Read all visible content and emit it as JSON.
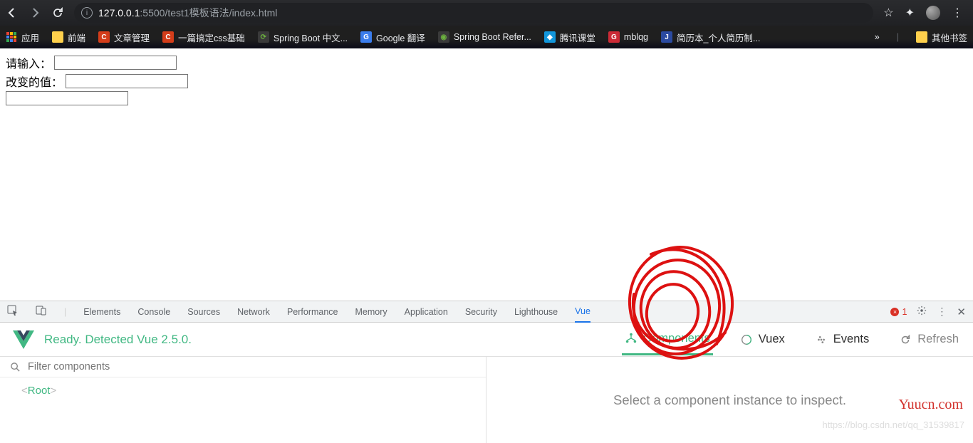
{
  "browser": {
    "url_host": "127.0.0.1",
    "url_port": ":5500",
    "url_path": "/test1模板语法/index.html",
    "bookmarks": [
      {
        "label": "应用",
        "color": "transparent",
        "glyph": ""
      },
      {
        "label": "前端",
        "color": "#ffd04c",
        "glyph": ""
      },
      {
        "label": "文章管理",
        "color": "#d43d1a",
        "glyph": "C"
      },
      {
        "label": "一篇搞定css基础",
        "color": "#d43d1a",
        "glyph": "C"
      },
      {
        "label": "Spring Boot 中文...",
        "color": "#3a3a3a",
        "glyph": "⟳"
      },
      {
        "label": "Google 翻译",
        "color": "#3b7ded",
        "glyph": "G"
      },
      {
        "label": "Spring Boot Refer...",
        "color": "#3a3a3a",
        "glyph": "◉"
      },
      {
        "label": "腾讯课堂",
        "color": "#1296db",
        "glyph": "◆"
      },
      {
        "label": "mblqg",
        "color": "#cc2a36",
        "glyph": "G"
      },
      {
        "label": "简历本_个人简历制...",
        "color": "#2b4aa0",
        "glyph": "J"
      }
    ],
    "other_bookmarks": "其他书签"
  },
  "page": {
    "label1": "请输入：",
    "label2": "改变的值：",
    "input1": "",
    "input2": "",
    "input3": ""
  },
  "devtools": {
    "tabs": [
      "Elements",
      "Console",
      "Sources",
      "Network",
      "Performance",
      "Memory",
      "Application",
      "Security",
      "Lighthouse",
      "Vue"
    ],
    "active_tab": "Vue",
    "error_count": "1",
    "vue": {
      "ready_text": "Ready. Detected Vue 2.5.0.",
      "tabs": {
        "components": "Components",
        "vuex": "Vuex",
        "events": "Events",
        "refresh": "Refresh"
      },
      "filter_placeholder": "Filter components",
      "root_label": "Root",
      "inspect_hint": "Select a component instance to inspect.",
      "hint_url": "https://blog.csdn.net/qq_31539817"
    }
  },
  "watermark": "Yuucn.com"
}
